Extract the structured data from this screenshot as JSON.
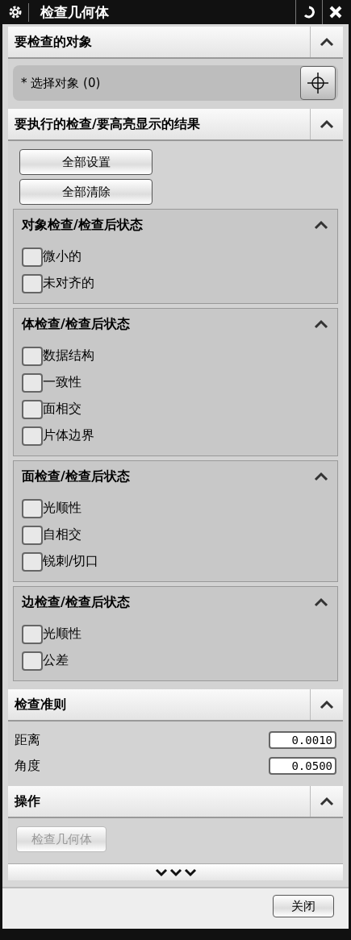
{
  "window": {
    "title": "检查几何体"
  },
  "sections": [
    {
      "kind": "select",
      "title": "要检查的对象",
      "expanded": true,
      "select": {
        "required_mark": "*",
        "label": "选择对象",
        "count": "(0)"
      }
    },
    {
      "kind": "checks",
      "title": "要执行的检查/要高亮显示的结果",
      "expanded": true,
      "buttons": [
        "全部设置",
        "全部清除"
      ],
      "groups": [
        {
          "title": "对象检查/检查后状态",
          "expanded": true,
          "items": [
            {
              "label": "微小的",
              "checked": false
            },
            {
              "label": "未对齐的",
              "checked": false
            }
          ]
        },
        {
          "title": "体检查/检查后状态",
          "expanded": true,
          "items": [
            {
              "label": "数据结构",
              "checked": false
            },
            {
              "label": "一致性",
              "checked": false
            },
            {
              "label": "面相交",
              "checked": false
            },
            {
              "label": "片体边界",
              "checked": false
            }
          ]
        },
        {
          "title": "面检查/检查后状态",
          "expanded": true,
          "items": [
            {
              "label": "光顺性",
              "checked": false
            },
            {
              "label": "自相交",
              "checked": false
            },
            {
              "label": "锐刺/切口",
              "checked": false
            }
          ]
        },
        {
          "title": "边检查/检查后状态",
          "expanded": true,
          "items": [
            {
              "label": "光顺性",
              "checked": false
            },
            {
              "label": "公差",
              "checked": false
            }
          ]
        }
      ]
    },
    {
      "kind": "fields",
      "title": "检查准则",
      "expanded": true,
      "fields": [
        {
          "label": "距离",
          "value": "0.0010"
        },
        {
          "label": "角度",
          "value": "0.0500"
        }
      ]
    },
    {
      "kind": "actions",
      "title": "操作",
      "expanded": true,
      "actions": [
        {
          "label": "检查几何体",
          "disabled": true
        }
      ]
    }
  ],
  "footer": {
    "buttons": [
      "关闭"
    ]
  }
}
